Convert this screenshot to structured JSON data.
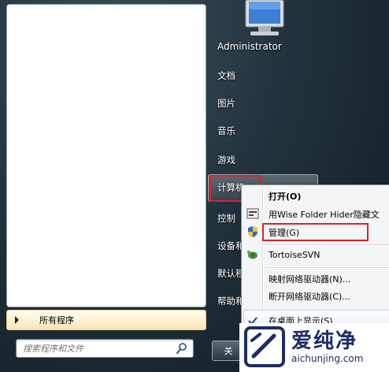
{
  "start_menu": {
    "user_name": "Administrator",
    "right_items": [
      {
        "label": "文档"
      },
      {
        "label": "图片"
      },
      {
        "label": "音乐"
      },
      {
        "label": "游戏"
      },
      {
        "label": "计算机"
      },
      {
        "label": "控制"
      },
      {
        "label": "设备和"
      },
      {
        "label": "默认程"
      },
      {
        "label": "帮助和"
      }
    ],
    "all_programs": "所有程序",
    "search_placeholder": "搜索程序和文件",
    "shutdown_label": "关"
  },
  "context_menu": {
    "items": [
      {
        "label": "打开(O)",
        "bold": true
      },
      {
        "label": "用Wise Folder Hider隐藏文"
      },
      {
        "label": "管理(G)",
        "icon": "uac-shield-icon"
      },
      {
        "label": "TortoiseSVN",
        "icon": "tortoisesvn-icon"
      },
      {
        "label": "映射网络驱动器(N)..."
      },
      {
        "label": "断开网络驱动器(C)..."
      },
      {
        "label": "在桌面上显示(S)",
        "checked": true
      }
    ]
  },
  "watermark": {
    "title": "爱纯净",
    "subtitle": "aichunjing.com"
  },
  "colors": {
    "highlight_red": "#e0202a",
    "watermark_blue": "#1d2c66"
  }
}
